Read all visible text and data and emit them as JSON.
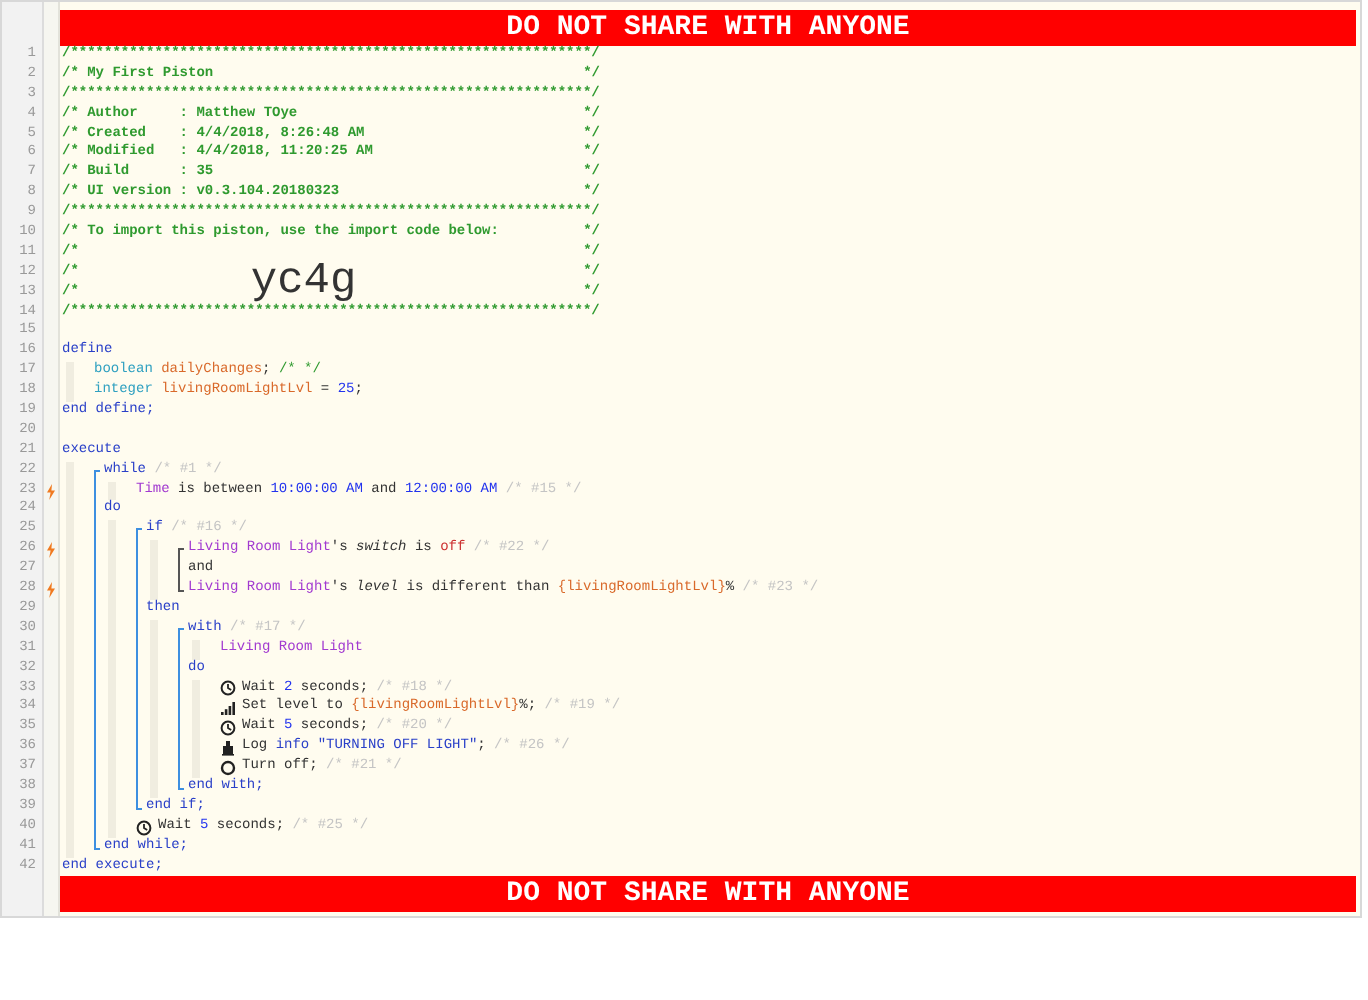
{
  "top_banner": "DO NOT SHARE WITH ANYONE",
  "code": [
    {
      "kind": "header",
      "number": "1",
      "trigger": false,
      "segments": [
        {
          "kind": "header",
          "text": "/**************************************************************/"
        }
      ]
    },
    {
      "kind": "header",
      "number": "2",
      "trigger": false,
      "segments": [
        {
          "kind": "header",
          "text": "/* My First Piston"
        },
        {
          "kind": "header",
          "text": "*/"
        }
      ]
    },
    {
      "kind": "header",
      "number": "3",
      "trigger": false,
      "segments": [
        {
          "kind": "header",
          "text": "/**************************************************************/"
        }
      ]
    },
    {
      "kind": "header",
      "number": "4",
      "trigger": false,
      "segments": [
        {
          "kind": "header",
          "text": "/* Author     : Matthew TOye"
        },
        {
          "kind": "header",
          "text": "*/"
        }
      ]
    },
    {
      "kind": "header",
      "number": "5",
      "trigger": false,
      "segments": [
        {
          "kind": "header",
          "text": "/* Created    : 4/4/2018, 8:26:48 AM"
        },
        {
          "kind": "header",
          "text": "*/"
        }
      ]
    },
    {
      "kind": "header",
      "number": "6",
      "trigger": false,
      "segments": [
        {
          "kind": "header",
          "text": "/* Modified   : 4/4/2018, 11:20:25 AM"
        },
        {
          "kind": "header",
          "text": "*/"
        }
      ]
    },
    {
      "kind": "header",
      "number": "7",
      "trigger": false,
      "segments": [
        {
          "kind": "header",
          "text": "/* Build      : 35"
        },
        {
          "kind": "header",
          "text": "*/"
        }
      ]
    },
    {
      "kind": "header",
      "number": "8",
      "trigger": false,
      "segments": [
        {
          "kind": "header",
          "text": "/* UI version : v0.3.104.20180323"
        },
        {
          "kind": "header",
          "text": "*/"
        }
      ]
    },
    {
      "kind": "header",
      "number": "9",
      "trigger": false,
      "segments": [
        {
          "kind": "header",
          "text": "/**************************************************************/"
        }
      ]
    },
    {
      "kind": "header",
      "number": "10",
      "trigger": false,
      "segments": [
        {
          "kind": "header",
          "text": "/* To import this piston, use the import code below:"
        },
        {
          "kind": "header",
          "text": "*/"
        }
      ]
    },
    {
      "kind": "header",
      "number": "11",
      "trigger": false,
      "segments": [
        {
          "kind": "header",
          "text": "/*"
        },
        {
          "kind": "header",
          "text": "*/"
        }
      ]
    },
    {
      "kind": "header",
      "number": "12",
      "trigger": false,
      "segments": [
        {
          "kind": "header",
          "text": "/*"
        },
        {
          "kind": "import_code",
          "text": "yc4g"
        },
        {
          "kind": "header",
          "text": "*/"
        }
      ]
    },
    {
      "kind": "header",
      "number": "13",
      "trigger": false,
      "segments": [
        {
          "kind": "header",
          "text": "/*"
        },
        {
          "kind": "header",
          "text": "*/"
        }
      ]
    },
    {
      "kind": "header",
      "number": "14",
      "trigger": false,
      "segments": [
        {
          "kind": "header",
          "text": "/**************************************************************/"
        }
      ]
    },
    {
      "kind": "line",
      "number": "15",
      "trigger": false
    },
    {
      "kind": "line",
      "number": "16",
      "trigger": false,
      "segments": [
        {
          "kind": "keyword",
          "text": "define"
        }
      ]
    },
    {
      "kind": "block",
      "children": [
        {
          "kind": "line",
          "number": "17",
          "trigger": false,
          "segments": [
            {
              "kind": "type",
              "text": "boolean "
            },
            {
              "kind": "variable",
              "text": "dailyChanges"
            },
            {
              "kind": "text",
              "text": "; "
            },
            {
              "kind": "comment",
              "text": "/* */"
            }
          ]
        },
        {
          "kind": "line",
          "number": "18",
          "trigger": false,
          "segments": [
            {
              "kind": "type",
              "text": "integer "
            },
            {
              "kind": "variable",
              "text": "livingRoomLightLvl"
            },
            {
              "kind": "text",
              "text": " = "
            },
            {
              "kind": "number",
              "text": "25"
            },
            {
              "kind": "text",
              "text": ";"
            }
          ]
        }
      ]
    },
    {
      "kind": "line",
      "number": "19",
      "trigger": false,
      "segments": [
        {
          "kind": "keyword",
          "text": "end define;"
        }
      ]
    },
    {
      "kind": "line",
      "number": "20",
      "trigger": false
    },
    {
      "kind": "line",
      "number": "21",
      "trigger": false,
      "segments": [
        {
          "kind": "keyword",
          "text": "execute"
        }
      ]
    },
    {
      "kind": "block",
      "children": [
        {
          "kind": "statement_group",
          "children": [
            {
              "kind": "line",
              "number": "22",
              "trigger": false,
              "segments": [
                {
                  "kind": "keyword",
                  "text": "while "
                },
                {
                  "kind": "note",
                  "text": "/* #1 */"
                }
              ]
            },
            {
              "kind": "block",
              "children": [
                {
                  "kind": "line",
                  "number": "23",
                  "trigger": true,
                  "segments": [
                    {
                      "kind": "device",
                      "text": "Time"
                    },
                    {
                      "kind": "text",
                      "text": " is between "
                    },
                    {
                      "kind": "number",
                      "text": "10:00:00 AM"
                    },
                    {
                      "kind": "text",
                      "text": " and "
                    },
                    {
                      "kind": "number",
                      "text": "12:00:00 AM"
                    },
                    {
                      "kind": "note",
                      "text": " /* #15 */"
                    }
                  ]
                }
              ]
            },
            {
              "kind": "line",
              "number": "24",
              "trigger": false,
              "segments": [
                {
                  "kind": "keyword",
                  "text": "do"
                }
              ]
            },
            {
              "kind": "block",
              "children": [
                {
                  "kind": "statement_group",
                  "children": [
                    {
                      "kind": "line",
                      "number": "25",
                      "trigger": false,
                      "segments": [
                        {
                          "kind": "keyword",
                          "text": "if "
                        },
                        {
                          "kind": "note",
                          "text": "/* #16 */"
                        }
                      ]
                    },
                    {
                      "kind": "block",
                      "children": [
                        {
                          "kind": "condition_group",
                          "children": [
                            {
                              "kind": "line",
                              "number": "26",
                              "trigger": true,
                              "segments": [
                                {
                                  "kind": "device",
                                  "text": "Living Room Light"
                                },
                                {
                                  "kind": "text",
                                  "text": "'s "
                                },
                                {
                                  "kind": "attribute",
                                  "text": "switch"
                                },
                                {
                                  "kind": "text",
                                  "text": " is "
                                },
                                {
                                  "kind": "value",
                                  "text": "off"
                                },
                                {
                                  "kind": "note",
                                  "text": " /* #22 */"
                                }
                              ]
                            },
                            {
                              "kind": "line",
                              "number": "27",
                              "trigger": false,
                              "segments": [
                                {
                                  "kind": "text",
                                  "text": "and"
                                }
                              ]
                            },
                            {
                              "kind": "line",
                              "number": "28",
                              "trigger": true,
                              "segments": [
                                {
                                  "kind": "device",
                                  "text": "Living Room Light"
                                },
                                {
                                  "kind": "text",
                                  "text": "'s "
                                },
                                {
                                  "kind": "attribute",
                                  "text": "level"
                                },
                                {
                                  "kind": "text",
                                  "text": " is different than "
                                },
                                {
                                  "kind": "variable",
                                  "text": "{livingRoomLightLvl}"
                                },
                                {
                                  "kind": "text",
                                  "text": "%"
                                },
                                {
                                  "kind": "note",
                                  "text": " /* #23 */"
                                }
                              ]
                            }
                          ]
                        }
                      ]
                    },
                    {
                      "kind": "line",
                      "number": "29",
                      "trigger": false,
                      "segments": [
                        {
                          "kind": "keyword",
                          "text": "then"
                        }
                      ]
                    },
                    {
                      "kind": "block",
                      "children": [
                        {
                          "kind": "statement_group",
                          "children": [
                            {
                              "kind": "line",
                              "number": "30",
                              "trigger": false,
                              "segments": [
                                {
                                  "kind": "keyword",
                                  "text": "with "
                                },
                                {
                                  "kind": "note",
                                  "text": "/* #17 */"
                                }
                              ]
                            },
                            {
                              "kind": "block",
                              "children": [
                                {
                                  "kind": "line",
                                  "number": "31",
                                  "trigger": false,
                                  "segments": [
                                    {
                                      "kind": "device",
                                      "text": "Living Room Light"
                                    }
                                  ]
                                }
                              ]
                            },
                            {
                              "kind": "line",
                              "number": "32",
                              "trigger": false,
                              "segments": [
                                {
                                  "kind": "keyword",
                                  "text": "do"
                                }
                              ]
                            },
                            {
                              "kind": "block",
                              "children": [
                                {
                                  "kind": "wait",
                                  "number": "33",
                                  "trigger": false,
                                  "segments": [
                                    {
                                      "kind": "text",
                                      "text": "Wait "
                                    },
                                    {
                                      "kind": "number",
                                      "text": "2"
                                    },
                                    {
                                      "kind": "text",
                                      "text": " seconds;"
                                    },
                                    {
                                      "kind": "note",
                                      "text": " /* #18 */"
                                    }
                                  ]
                                },
                                {
                                  "kind": "level",
                                  "number": "34",
                                  "trigger": false,
                                  "segments": [
                                    {
                                      "kind": "text",
                                      "text": "Set level to "
                                    },
                                    {
                                      "kind": "variable",
                                      "text": "{livingRoomLightLvl}"
                                    },
                                    {
                                      "kind": "text",
                                      "text": "%;"
                                    },
                                    {
                                      "kind": "note",
                                      "text": " /* #19 */"
                                    }
                                  ]
                                },
                                {
                                  "kind": "wait",
                                  "number": "35",
                                  "trigger": false,
                                  "segments": [
                                    {
                                      "kind": "text",
                                      "text": "Wait "
                                    },
                                    {
                                      "kind": "number",
                                      "text": "5"
                                    },
                                    {
                                      "kind": "text",
                                      "text": " seconds;"
                                    },
                                    {
                                      "kind": "note",
                                      "text": " /* #20 */"
                                    }
                                  ]
                                },
                                {
                                  "kind": "log",
                                  "number": "36",
                                  "trigger": false,
                                  "segments": [
                                    {
                                      "kind": "text",
                                      "text": "Log "
                                    },
                                    {
                                      "kind": "keyword",
                                      "text": "info"
                                    },
                                    {
                                      "kind": "string",
                                      "text": " \"TURNING OFF LIGHT\""
                                    },
                                    {
                                      "kind": "text",
                                      "text": ";"
                                    },
                                    {
                                      "kind": "note",
                                      "text": " /* #26 */"
                                    }
                                  ]
                                },
                                {
                                  "kind": "power",
                                  "number": "37",
                                  "trigger": false,
                                  "segments": [
                                    {
                                      "kind": "text",
                                      "text": "Turn off;"
                                    },
                                    {
                                      "kind": "note",
                                      "text": " /* #21 */"
                                    }
                                  ]
                                }
                              ]
                            },
                            {
                              "kind": "line",
                              "number": "38",
                              "trigger": false,
                              "segments": [
                                {
                                  "kind": "keyword",
                                  "text": "end with;"
                                }
                              ]
                            }
                          ]
                        }
                      ]
                    },
                    {
                      "kind": "line",
                      "number": "39",
                      "trigger": false,
                      "segments": [
                        {
                          "kind": "keyword",
                          "text": "end if;"
                        }
                      ]
                    }
                  ]
                },
                {
                  "kind": "wait",
                  "number": "40",
                  "trigger": false,
                  "segments": [
                    {
                      "kind": "text",
                      "text": "Wait "
                    },
                    {
                      "kind": "number",
                      "text": "5"
                    },
                    {
                      "kind": "text",
                      "text": " seconds;"
                    },
                    {
                      "kind": "note",
                      "text": " /* #25 */"
                    }
                  ]
                }
              ]
            },
            {
              "kind": "line",
              "number": "41",
              "trigger": false,
              "segments": [
                {
                  "kind": "keyword",
                  "text": "end while;"
                }
              ]
            }
          ]
        }
      ]
    },
    {
      "kind": "line",
      "number": "42",
      "trigger": false,
      "segments": [
        {
          "kind": "keyword",
          "text": "end execute;"
        }
      ]
    }
  ],
  "bottom_banner": "DO NOT SHARE WITH ANYONE"
}
